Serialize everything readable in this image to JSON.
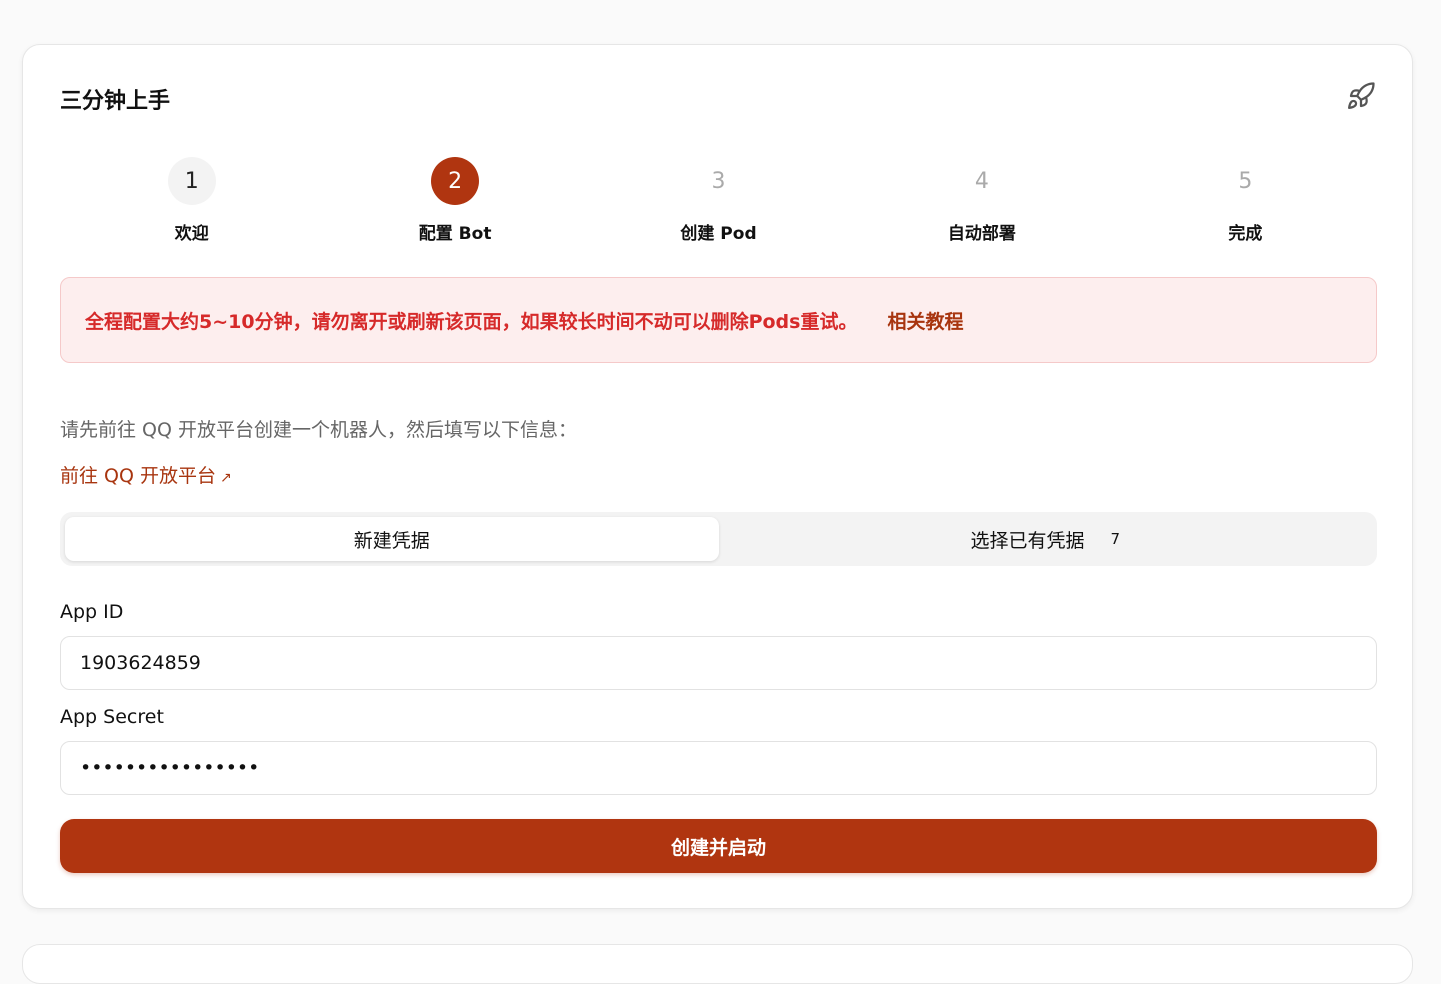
{
  "card": {
    "title": "三分钟上手",
    "icon": "rocket-icon"
  },
  "steps": [
    {
      "number": "1",
      "label": "欢迎",
      "state": "done"
    },
    {
      "number": "2",
      "label": "配置 Bot",
      "state": "active"
    },
    {
      "number": "3",
      "label": "创建 Pod",
      "state": "pending"
    },
    {
      "number": "4",
      "label": "自动部署",
      "state": "pending"
    },
    {
      "number": "5",
      "label": "完成",
      "state": "pending"
    }
  ],
  "alert": {
    "text": "全程配置大约5~10分钟，请勿离开或刷新该页面，如果较长时间不动可以删除Pods重试。",
    "link": "相关教程"
  },
  "intro": "请先前往 QQ 开放平台创建一个机器人，然后填写以下信息：",
  "external_link": {
    "label": "前往 QQ 开放平台",
    "arrow": "↗"
  },
  "credential_tabs": [
    {
      "label": "新建凭据",
      "active": true
    },
    {
      "label": "选择已有凭据",
      "badge": "7",
      "active": false
    }
  ],
  "form": {
    "app_id_label": "App ID",
    "app_id_value": "1903624859",
    "app_secret_label": "App Secret",
    "app_secret_value": "••••••••••••••••"
  },
  "submit_label": "创建并启动",
  "colors": {
    "accent": "#b03510",
    "alert_bg": "#fdeeee",
    "alert_text": "#d62a2a"
  }
}
